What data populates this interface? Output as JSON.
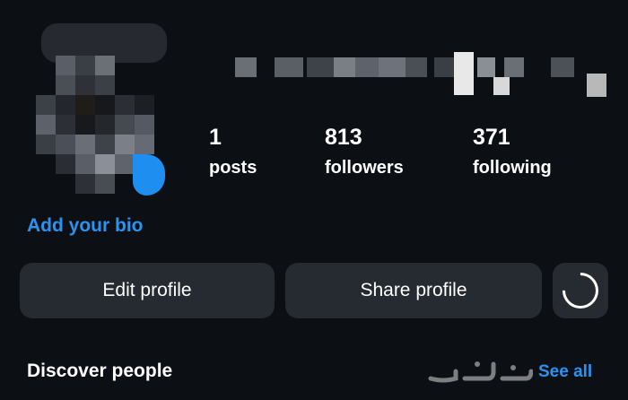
{
  "profile": {
    "stats": [
      {
        "value": "1",
        "label": "posts"
      },
      {
        "value": "813",
        "label": "followers"
      },
      {
        "value": "371",
        "label": "following"
      }
    ],
    "bio_link": "Add your bio"
  },
  "actions": {
    "edit_label": "Edit profile",
    "share_label": "Share profile",
    "discover_icon": "discover-people-icon"
  },
  "discover": {
    "title": "Discover people",
    "see_all": "See all"
  },
  "colors": {
    "background": "#0c1015",
    "button": "#262a31",
    "accent": "#2a93f1"
  }
}
